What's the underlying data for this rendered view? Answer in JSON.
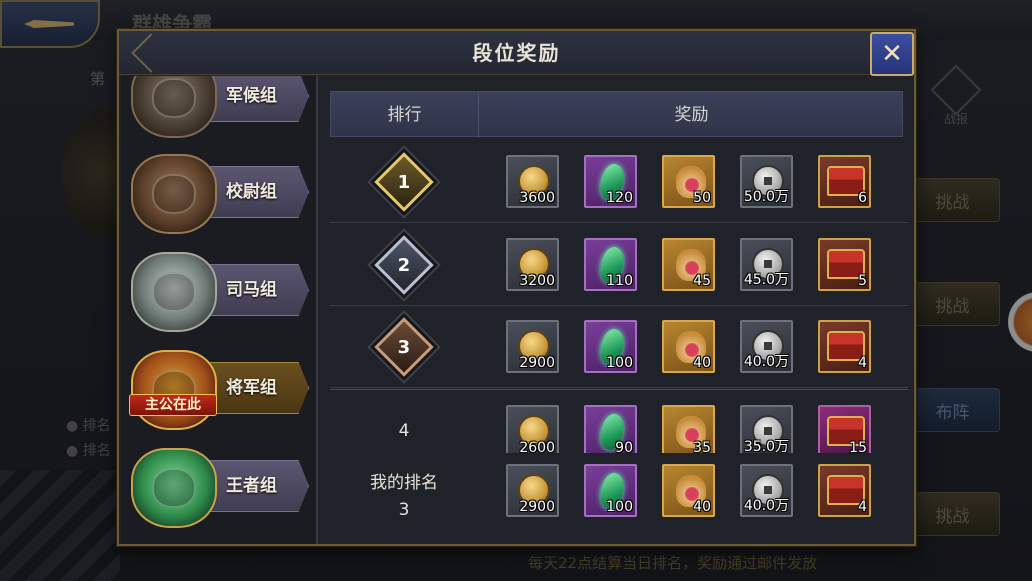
{
  "background": {
    "title": "群雄争霸",
    "rank_prefix": "第",
    "bullet_1": "排名",
    "bullet_2": "排名",
    "zhanbao_label": "战报",
    "btn_challenge_1": "挑战",
    "btn_challenge_2": "挑战",
    "btn_lineup": "布阵",
    "btn_challenge_3": "挑战",
    "bottom_note": "每天22点结算当日排名，奖励通过邮件发放"
  },
  "dialog": {
    "title": "段位奖励",
    "close_icon": "close-x-icon"
  },
  "tiers": [
    {
      "label": "军候组",
      "icon": "bronze-demon-badge-icon"
    },
    {
      "label": "校尉组",
      "icon": "copper-tiger-badge-icon"
    },
    {
      "label": "司马组",
      "icon": "silver-lion-badge-icon"
    },
    {
      "label": "将军组",
      "icon": "gold-warrior-badge-icon",
      "active": true,
      "tag": "主公在此"
    },
    {
      "label": "王者组",
      "icon": "jade-dragon-badge-icon"
    }
  ],
  "table": {
    "col_rank": "排行",
    "col_reward": "奖励",
    "rows": [
      {
        "rank": "1",
        "rewards": [
          "3600",
          "120",
          "50",
          "50.0万",
          "6"
        ]
      },
      {
        "rank": "2",
        "rewards": [
          "3200",
          "110",
          "45",
          "45.0万",
          "5"
        ]
      },
      {
        "rank": "3",
        "rewards": [
          "2900",
          "100",
          "40",
          "40.0万",
          "4"
        ]
      },
      {
        "rank": "4",
        "rewards": [
          "2600",
          "90",
          "35",
          "35.0万",
          "15"
        ]
      }
    ],
    "my_rank": {
      "label": "我的排名",
      "rank": "3",
      "rewards": [
        "2900",
        "100",
        "40",
        "40.0万",
        "4"
      ]
    }
  },
  "reward_icons": [
    "gold-coin-icon",
    "jade-icon",
    "money-bag-icon",
    "copper-cash-icon",
    "treasure-chest-icon"
  ]
}
